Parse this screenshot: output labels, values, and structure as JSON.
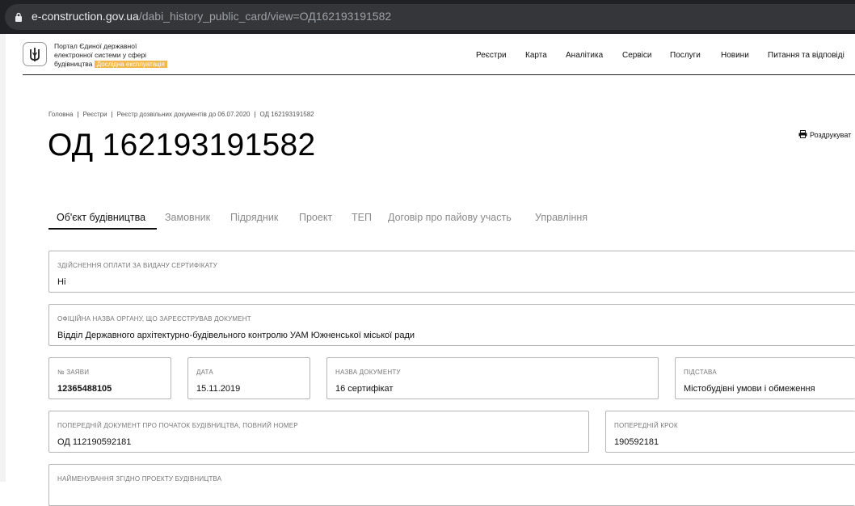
{
  "browser": {
    "url_domain": "e-construction.gov.ua",
    "url_path": "/dabi_history_public_card/view=ОД162193191582"
  },
  "header": {
    "portal_line1": "Портал Єдиної державної",
    "portal_line2": "електронної системи у сфері",
    "portal_line3": "будівництва",
    "badge": "Дослідна експлуатація",
    "nav": [
      "Реєстри",
      "Карта",
      "Аналітика",
      "Сервіси",
      "Послуги",
      "Новини",
      "Питання та відповіді"
    ]
  },
  "breadcrumbs": [
    "Головна",
    "Реєстри",
    "Реєстр дозвільних документів до 06.07.2020",
    "ОД 162193191582"
  ],
  "page_title": "ОД 162193191582",
  "print_label": "Роздрукуват",
  "tabs": [
    "Об'єкт будівництва",
    "Замовник",
    "Підрядник",
    "Проект",
    "ТЕП",
    "Договір про пайову участь",
    "Управління"
  ],
  "fields": {
    "payment": {
      "label": "Здійснення оплати за видачу сертифікату",
      "value": "Ні"
    },
    "authority": {
      "label": "Офіційна назва органу, що зареєстрував документ",
      "value": "Відділ Державного архітектурно-будівельного контролю УАМ Южненської міської ради"
    },
    "application_no": {
      "label": "№ заяви",
      "value": "12365488105"
    },
    "date": {
      "label": "Дата",
      "value": "15.11.2019"
    },
    "doc_name": {
      "label": "Назва документу",
      "value": "16 сертифікат"
    },
    "basis": {
      "label": "Підстава",
      "value": "Містобудівні умови і обмеження"
    },
    "prev_doc": {
      "label": "Попередній документ про початок будівництва, повний номер",
      "value": "ОД 112190592181"
    },
    "prev_step": {
      "label": "Попередній крок",
      "value": "190592181"
    },
    "project_name": {
      "label": "Найменування згідно проекту будівництва",
      "value": ""
    }
  }
}
